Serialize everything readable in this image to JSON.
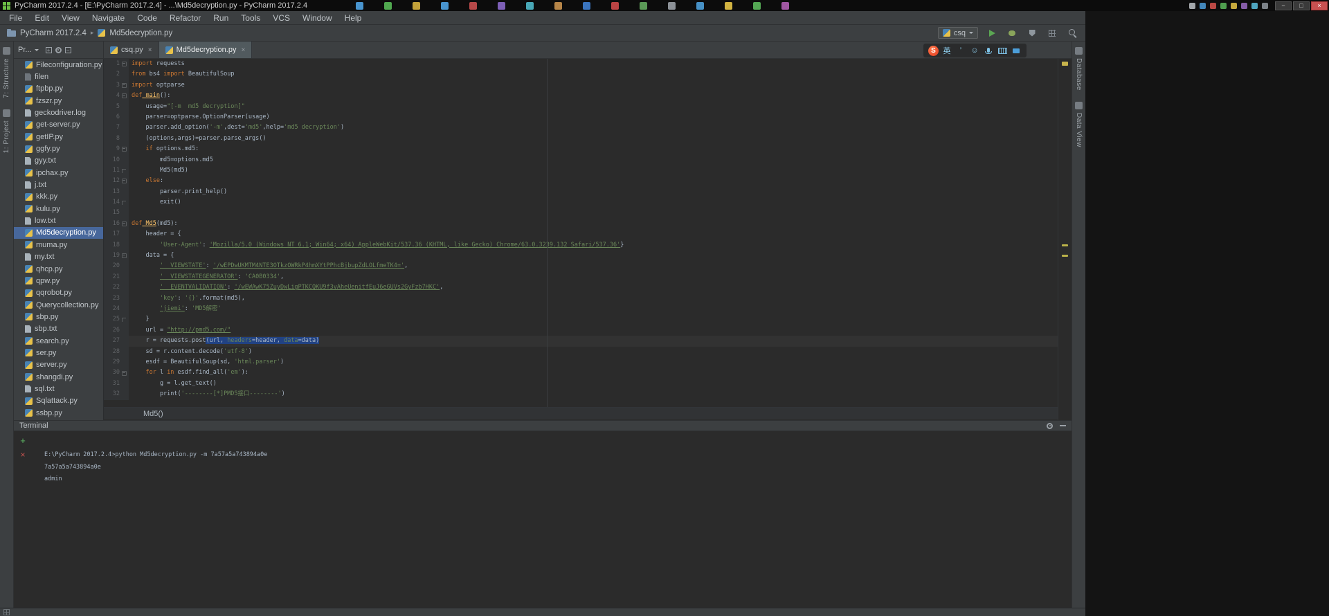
{
  "taskbar": {
    "active_task_title": "PyCharm 2017.2.4 - [E:\\PyCharm 2017.2.4] - ...\\Md5decryption.py - PyCharm 2017.2.4",
    "minimize_label": "−",
    "maximize_label": "□",
    "close_label": "×",
    "task_icon_colors": [
      "#4FA3E3",
      "#58B957",
      "#D8B23F",
      "#4FA3E3",
      "#C94F4F",
      "#8A68C9",
      "#4FB8C9",
      "#C9924F",
      "#3F7FD2",
      "#CE4A4A",
      "#63A85E",
      "#9AA0A6",
      "#4C9ED9",
      "#E8C547",
      "#5CB85C",
      "#B05FB2"
    ],
    "tray_icon_colors": [
      "#C0C4C8",
      "#4C9ED9",
      "#D9534F",
      "#5CB85C",
      "#E8C547",
      "#9B6BC3",
      "#5BC0DE",
      "#8F979E"
    ]
  },
  "menu": {
    "items": [
      "File",
      "Edit",
      "View",
      "Navigate",
      "Code",
      "Refactor",
      "Run",
      "Tools",
      "VCS",
      "Window",
      "Help"
    ]
  },
  "toolbar": {
    "project": "PyCharm 2017.2.4",
    "file": "Md5decryption.py",
    "run_config": "csq"
  },
  "tool_strips": {
    "left": [
      "7: Structure",
      "1: Project"
    ],
    "right": [
      "Database",
      "Data View"
    ]
  },
  "project": {
    "toolbar_label": "Pr...",
    "files": [
      {
        "name": "Fileconfiguration.py",
        "type": "py"
      },
      {
        "name": "filen",
        "type": "file"
      },
      {
        "name": "ftpbp.py",
        "type": "py"
      },
      {
        "name": "fzszr.py",
        "type": "py"
      },
      {
        "name": "geckodriver.log",
        "type": "txt"
      },
      {
        "name": "get-server.py",
        "type": "py"
      },
      {
        "name": "getIP.py",
        "type": "py"
      },
      {
        "name": "ggfy.py",
        "type": "py"
      },
      {
        "name": "gyy.txt",
        "type": "txt"
      },
      {
        "name": "ipchax.py",
        "type": "py"
      },
      {
        "name": "j.txt",
        "type": "txt"
      },
      {
        "name": "kkk.py",
        "type": "py"
      },
      {
        "name": "kulu.py",
        "type": "py"
      },
      {
        "name": "low.txt",
        "type": "txt"
      },
      {
        "name": "Md5decryption.py",
        "type": "py",
        "selected": true
      },
      {
        "name": "muma.py",
        "type": "py"
      },
      {
        "name": "my.txt",
        "type": "txt"
      },
      {
        "name": "qhcp.py",
        "type": "py"
      },
      {
        "name": "qpw.py",
        "type": "py"
      },
      {
        "name": "qqrobot.py",
        "type": "py"
      },
      {
        "name": "Querycollection.py",
        "type": "py"
      },
      {
        "name": "sbp.py",
        "type": "py"
      },
      {
        "name": "sbp.txt",
        "type": "txt"
      },
      {
        "name": "search.py",
        "type": "py"
      },
      {
        "name": "ser.py",
        "type": "py"
      },
      {
        "name": "server.py",
        "type": "py"
      },
      {
        "name": "shangdi.py",
        "type": "py"
      },
      {
        "name": "sql.txt",
        "type": "txt"
      },
      {
        "name": "Sqlattack.py",
        "type": "py"
      },
      {
        "name": "ssbp.py",
        "type": "py"
      }
    ]
  },
  "tabs": [
    {
      "label": "csq.py"
    },
    {
      "label": "Md5decryption.py",
      "active": true
    }
  ],
  "ime": {
    "logo_text": "S",
    "items": [
      {
        "name": "language-toggle-icon",
        "glyph": "英"
      },
      {
        "name": "punctuation-icon",
        "glyph": "’"
      },
      {
        "name": "emoji-picker-icon",
        "glyph": "☺"
      },
      {
        "name": "voice-input-icon",
        "glyph": ""
      },
      {
        "name": "soft-keyboard-icon",
        "glyph": ""
      },
      {
        "name": "toolbox-icon",
        "glyph": ""
      }
    ]
  },
  "editor": {
    "breadcrumb": "Md5()",
    "lines": [
      {
        "no": "1",
        "fold": "-",
        "segs": [
          [
            "tk",
            "import"
          ],
          [
            "tp",
            " requests"
          ]
        ]
      },
      {
        "no": "2",
        "segs": [
          [
            "tk",
            "from"
          ],
          [
            "tp",
            " bs4 "
          ],
          [
            "tk",
            "import"
          ],
          [
            "tp",
            " BeautifulSoup"
          ]
        ]
      },
      {
        "no": "3",
        "fold": "-",
        "segs": [
          [
            "tk",
            "import"
          ],
          [
            "tp",
            " optparse"
          ]
        ]
      },
      {
        "no": "4",
        "fold": "-",
        "segs": [
          [
            "tk",
            "def"
          ],
          [
            "tfu",
            " main"
          ],
          [
            "tp",
            "():"
          ]
        ]
      },
      {
        "no": "5",
        "segs": [
          [
            "tp",
            "    usage="
          ],
          [
            "ts",
            "\"[-m  md5 decryption]\""
          ]
        ]
      },
      {
        "no": "6",
        "segs": [
          [
            "tp",
            "    parser=optparse.OptionParser(usage)"
          ]
        ]
      },
      {
        "no": "7",
        "segs": [
          [
            "tp",
            "    parser.add_option("
          ],
          [
            "ts",
            "'-m'"
          ],
          [
            "tp",
            ",dest="
          ],
          [
            "ts",
            "'md5'"
          ],
          [
            "tp",
            ",help="
          ],
          [
            "ts",
            "'md5 decryption'"
          ],
          [
            "tp",
            ")"
          ]
        ]
      },
      {
        "no": "8",
        "segs": [
          [
            "tp",
            "    (options,args)=parser.parse_args()"
          ]
        ]
      },
      {
        "no": "9",
        "fold": "-",
        "segs": [
          [
            "tk",
            "    if"
          ],
          [
            "tp",
            " options.md5:"
          ]
        ]
      },
      {
        "no": "10",
        "segs": [
          [
            "tp",
            "        md5=options.md5"
          ]
        ]
      },
      {
        "no": "11",
        "fold": "e",
        "segs": [
          [
            "tp",
            "        Md5(md5)"
          ]
        ]
      },
      {
        "no": "12",
        "fold": "-",
        "segs": [
          [
            "tk",
            "    else"
          ],
          [
            "tp",
            ":"
          ]
        ]
      },
      {
        "no": "13",
        "segs": [
          [
            "tp",
            "        parser.print_help()"
          ]
        ]
      },
      {
        "no": "14",
        "fold": "e",
        "segs": [
          [
            "tp",
            "        exit()"
          ]
        ]
      },
      {
        "no": "15",
        "segs": [
          [
            "tp",
            ""
          ]
        ]
      },
      {
        "no": "16",
        "fold": "-",
        "segs": [
          [
            "tk",
            "def"
          ],
          [
            "tfu",
            " Md5"
          ],
          [
            "tp",
            "(md5):"
          ]
        ]
      },
      {
        "no": "17",
        "segs": [
          [
            "tp",
            "    header = {"
          ]
        ]
      },
      {
        "no": "18",
        "segs": [
          [
            "tp",
            "        "
          ],
          [
            "ts",
            "'User-Agent'"
          ],
          [
            "tp",
            ": "
          ],
          [
            "tsu",
            "'Mozilla/5.0 (Windows NT 6.1; Win64; x64) AppleWebKit/537.36 (KHTML, like Gecko) Chrome/63.0.3239.132 Safari/537.36'"
          ],
          [
            "tp",
            "}"
          ]
        ]
      },
      {
        "no": "19",
        "fold": "-",
        "segs": [
          [
            "tp",
            "    data = {"
          ]
        ]
      },
      {
        "no": "20",
        "segs": [
          [
            "tp",
            "        "
          ],
          [
            "tsu",
            "'__VIEWSTATE'"
          ],
          [
            "tp",
            ": "
          ],
          [
            "tsu",
            "'/wEPDwUKMTM4NTE3OTkzOWRkP4hmXYtPPhcBjbupZdLOLfmeTK4='"
          ],
          [
            "tp",
            ","
          ]
        ]
      },
      {
        "no": "21",
        "segs": [
          [
            "tp",
            "        "
          ],
          [
            "tsu",
            "'__VIEWSTATEGENERATOR'"
          ],
          [
            "tp",
            ": "
          ],
          [
            "ts",
            "'CA0B0334'"
          ],
          [
            "tp",
            ","
          ]
        ]
      },
      {
        "no": "22",
        "segs": [
          [
            "tp",
            "        "
          ],
          [
            "tsu",
            "'__EVENTVALIDATION'"
          ],
          [
            "tp",
            ": "
          ],
          [
            "tsu",
            "'/wEWAwK75ZuyDwLigPTKCQKU9f3vAheUenitfEuJ6eGUVs2GyFzb7HKC'"
          ],
          [
            "tp",
            ","
          ]
        ]
      },
      {
        "no": "23",
        "segs": [
          [
            "tp",
            "        "
          ],
          [
            "ts",
            "'key'"
          ],
          [
            "tp",
            ": "
          ],
          [
            "ts",
            "'{}'"
          ],
          [
            "tp",
            ".format(md5),"
          ]
        ]
      },
      {
        "no": "24",
        "segs": [
          [
            "tp",
            "        "
          ],
          [
            "tsu",
            "'jiemi'"
          ],
          [
            "tp",
            ": "
          ],
          [
            "ts",
            "'MD5解密'"
          ]
        ]
      },
      {
        "no": "25",
        "fold": "e",
        "segs": [
          [
            "tp",
            "    }"
          ]
        ]
      },
      {
        "no": "26",
        "segs": [
          [
            "tp",
            "    url = "
          ],
          [
            "tsu",
            "\"http://pmd5.com/\""
          ]
        ]
      },
      {
        "no": "27",
        "hl": true,
        "segs": [
          [
            "tp",
            "    r = requests.post"
          ],
          [
            "tp sel",
            "(url, "
          ],
          [
            "na sel",
            "headers"
          ],
          [
            "tp sel",
            "=header, "
          ],
          [
            "na sel",
            "data"
          ],
          [
            "tp sel",
            "=data)"
          ]
        ]
      },
      {
        "no": "28",
        "segs": [
          [
            "tp",
            "    sd = r.content.decode("
          ],
          [
            "ts",
            "'utf-8'"
          ],
          [
            "tp",
            ")"
          ]
        ]
      },
      {
        "no": "29",
        "segs": [
          [
            "tp",
            "    esdf = BeautifulSoup(sd, "
          ],
          [
            "ts",
            "'html.parser'"
          ],
          [
            "tp",
            ")"
          ]
        ]
      },
      {
        "no": "30",
        "fold": "-",
        "segs": [
          [
            "tk",
            "    for"
          ],
          [
            "tp",
            " l "
          ],
          [
            "tk",
            "in"
          ],
          [
            "tp",
            " esdf.find_all("
          ],
          [
            "ts",
            "'em'"
          ],
          [
            "tp",
            "):"
          ]
        ]
      },
      {
        "no": "31",
        "segs": [
          [
            "tp",
            "        g = l.get_text()"
          ]
        ]
      },
      {
        "no": "32",
        "segs": [
          [
            "tp",
            "        print("
          ],
          [
            "ts",
            "'--------[*]PMD5接口--------'"
          ],
          [
            "tp",
            ")"
          ]
        ]
      }
    ]
  },
  "terminal": {
    "title": "Terminal",
    "lines": [
      "E:\\PyCharm 2017.2.4>python Md5decryption.py -m 7a57a5a743894a0e",
      "7a57a5a743894a0e",
      "admin"
    ]
  },
  "colors": {
    "run_accent": "#5BA653",
    "close_button": "#C75050",
    "selection": "#214283",
    "selected_file_row": "#47679B",
    "editor_bg": "#2B2B2B",
    "panel_bg": "#3C3F41"
  }
}
